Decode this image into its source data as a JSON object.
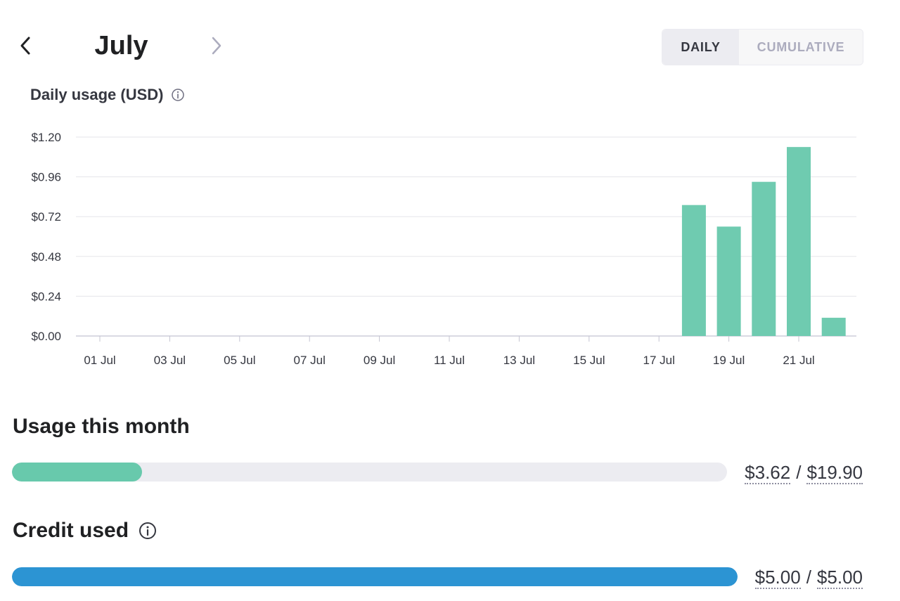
{
  "header": {
    "month": "July",
    "prev_icon": "chevron-left-icon",
    "next_icon": "chevron-right-icon",
    "toggle": {
      "daily_label": "DAILY",
      "cumulative_label": "CUMULATIVE",
      "selected": "DAILY"
    }
  },
  "chart_section": {
    "title": "Daily usage (USD)",
    "info_icon": "info-icon"
  },
  "chart_data": {
    "type": "bar",
    "title": "Daily usage (USD)",
    "xlabel": "",
    "ylabel": "",
    "ylim": [
      0,
      1.2
    ],
    "y_ticks": [
      "$0.00",
      "$0.24",
      "$0.48",
      "$0.72",
      "$0.96",
      "$1.20"
    ],
    "x_tick_labels": [
      "01 Jul",
      "03 Jul",
      "05 Jul",
      "07 Jul",
      "09 Jul",
      "11 Jul",
      "13 Jul",
      "15 Jul",
      "17 Jul",
      "19 Jul",
      "21 Jul"
    ],
    "categories": [
      "01 Jul",
      "02 Jul",
      "03 Jul",
      "04 Jul",
      "05 Jul",
      "06 Jul",
      "07 Jul",
      "08 Jul",
      "09 Jul",
      "10 Jul",
      "11 Jul",
      "12 Jul",
      "13 Jul",
      "14 Jul",
      "15 Jul",
      "16 Jul",
      "17 Jul",
      "18 Jul",
      "19 Jul",
      "20 Jul",
      "21 Jul",
      "22 Jul"
    ],
    "values": [
      0,
      0,
      0,
      0,
      0,
      0,
      0,
      0,
      0,
      0,
      0,
      0,
      0,
      0,
      0,
      0,
      0,
      0.79,
      0.66,
      0.93,
      1.14,
      0.11
    ],
    "grid": true,
    "bar_color": "#6fcbb0"
  },
  "usage": {
    "title": "Usage this month",
    "used": "$3.62",
    "separator": "/",
    "limit": "$19.90",
    "fraction": 0.182,
    "color": "#68c9ac"
  },
  "credit": {
    "title": "Credit used",
    "info_icon": "info-icon",
    "used": "$5.00",
    "separator": "/",
    "limit": "$5.00",
    "fraction": 1.0,
    "color": "#2c94d3"
  }
}
